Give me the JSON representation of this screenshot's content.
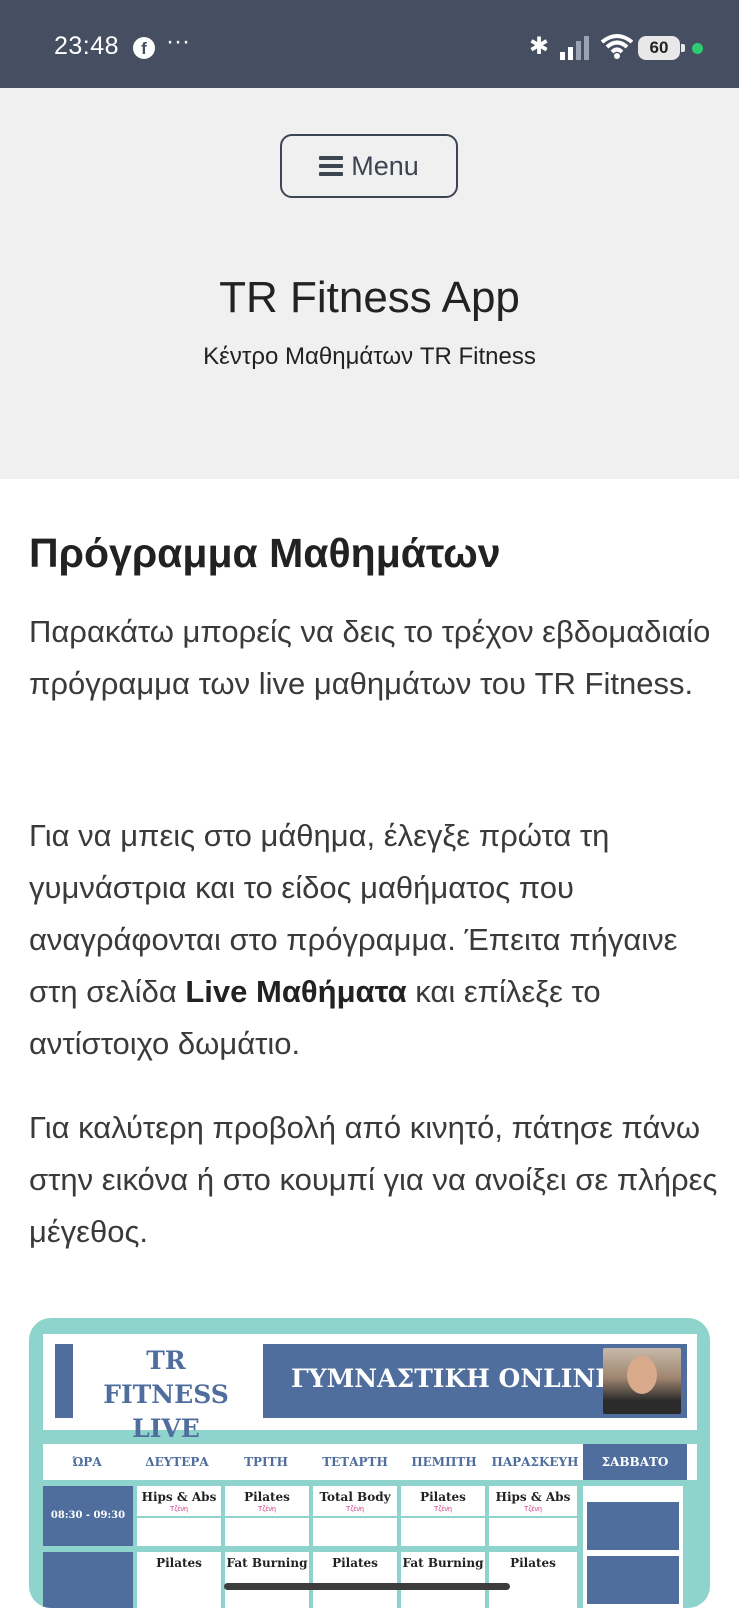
{
  "status_bar": {
    "time": "23:48",
    "more": "···",
    "battery": "60",
    "icons": [
      "facebook-icon",
      "bluetooth-icon",
      "signal-icon",
      "wifi-icon",
      "battery-icon",
      "privacy-dot"
    ]
  },
  "header": {
    "menu_label": "Menu",
    "site_title": "TR Fitness App",
    "site_subtitle": "Κέντρο Μαθημάτων TR Fitness"
  },
  "content": {
    "page_title": "Πρόγραμμα Μαθημάτων",
    "para1": "Παρακάτω μπορείς να δεις το τρέχον εβδομαδιαίο πρόγραμμα των live μαθημάτων του TR Fitness.",
    "para2_before": "Για να μπεις στο μάθημα, έλεγξε πρώτα τη γυμνάστρια και το είδος μαθήματος που αναγράφονται στο πρόγραμμα. Έπειτα πήγαινε στη σελίδα ",
    "para2_bold": "Live Μαθήματα",
    "para2_after": " και επίλεξε το αντίστοιχο δωμάτιο.",
    "para3": "Για καλύτερη προβολή από κινητό, πάτησε πάνω στην εικόνα ή στο κουμπί για να ανοίξει σε πλήρες μέγεθος."
  },
  "schedule": {
    "brand_line1": "TR FITNESS",
    "brand_line2": "LIVE",
    "banner": "ΓΥΜΝΑΣΤΙΚΗ ONLINE",
    "days": [
      "ΏΡΑ",
      "ΔΕΥΤΕΡΑ",
      "ΤΡΙΤΗ",
      "ΤΕΤΑΡΤΗ",
      "ΠΕΜΠΤΗ",
      "ΠΑΡΑΣΚΕΥΗ",
      "ΣΑΒΒΑΤΟ"
    ],
    "row1_time": "08:30 - 09:30",
    "row1": [
      {
        "title": "Hips & Abs",
        "sub": "Τζένη"
      },
      {
        "title": "Pilates",
        "sub": "Τζένη"
      },
      {
        "title": "Total Body",
        "sub": "Τζένη"
      },
      {
        "title": "Pilates",
        "sub": "Τζένη"
      },
      {
        "title": "Hips & Abs",
        "sub": "Τζένη"
      }
    ],
    "row2": [
      "Pilates",
      "Fat Burning",
      "Pilates",
      "Fat Burning",
      "Pilates"
    ]
  }
}
